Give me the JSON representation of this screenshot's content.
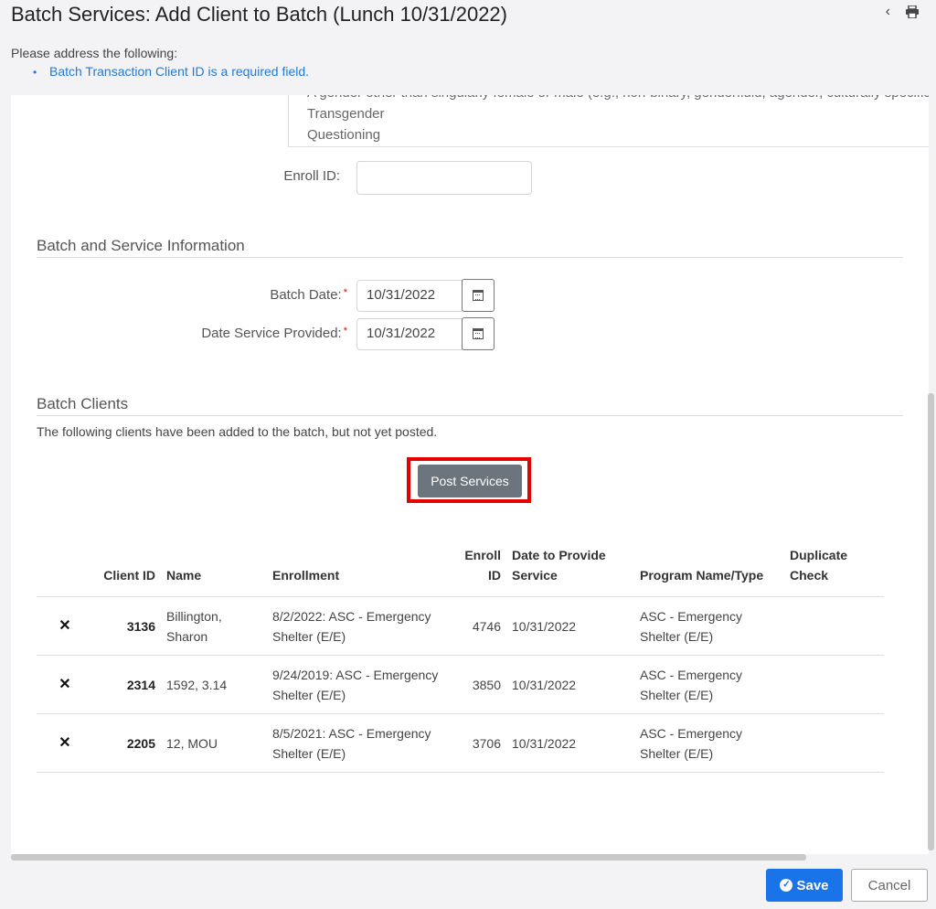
{
  "header": {
    "title": "Batch Services: Add Client to Batch (Lunch 10/31/2022)",
    "back_icon": "chevron-left-icon",
    "print_icon": "printer-icon"
  },
  "alert": {
    "intro": "Please address the following:",
    "items": [
      "Batch Transaction Client ID is a required field."
    ]
  },
  "gender_options": [
    "A gender other than singularly female or male (e.g., non-binary, genderfluid, agender, culturally specific gender)",
    "Transgender",
    "Questioning"
  ],
  "enroll": {
    "label": "Enroll ID:",
    "value": ""
  },
  "batch_service": {
    "section_title": "Batch and Service Information",
    "batch_date_label": "Batch Date:",
    "batch_date": "10/31/2022",
    "service_date_label": "Date Service Provided:",
    "service_date": "10/31/2022",
    "required_mark": "*"
  },
  "batch_clients": {
    "section_title": "Batch Clients",
    "note": "The following clients have been added to the batch, but not yet posted.",
    "post_button": "Post Services",
    "columns": [
      "Client ID",
      "Name",
      "Enrollment",
      "Enroll ID",
      "Date to Provide Service",
      "Program Name/Type",
      "Duplicate Check"
    ],
    "rows": [
      {
        "delete": "✕",
        "client_id": "3136",
        "name": "Billington, Sharon",
        "enrollment": "8/2/2022: ASC - Emergency Shelter (E/E)",
        "enroll_id": "4746",
        "date": "10/31/2022",
        "program": "ASC - Emergency Shelter (E/E)",
        "duplicate": ""
      },
      {
        "delete": "✕",
        "client_id": "2314",
        "name": "1592, 3.14",
        "enrollment": "9/24/2019: ASC - Emergency Shelter (E/E)",
        "enroll_id": "3850",
        "date": "10/31/2022",
        "program": "ASC - Emergency Shelter (E/E)",
        "duplicate": ""
      },
      {
        "delete": "✕",
        "client_id": "2205",
        "name": "12, MOU",
        "enrollment": "8/5/2021: ASC - Emergency Shelter (E/E)",
        "enroll_id": "3706",
        "date": "10/31/2022",
        "program": "ASC - Emergency Shelter (E/E)",
        "duplicate": ""
      }
    ]
  },
  "footer": {
    "save_label": "Save",
    "cancel_label": "Cancel"
  },
  "colors": {
    "accent": "#1a73e8",
    "post_button": "#6c757d",
    "highlight": "#e60000",
    "link": "#1f7ad8"
  }
}
